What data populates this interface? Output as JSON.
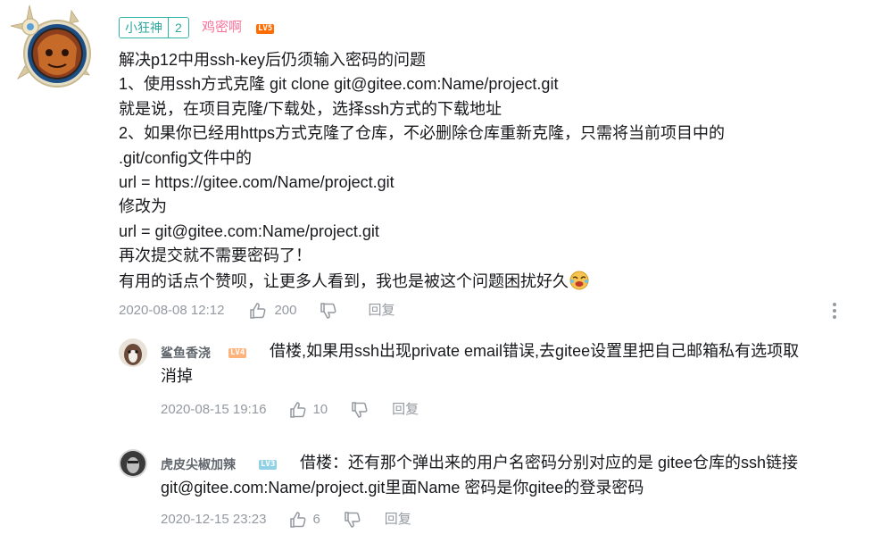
{
  "main_comment": {
    "medal_name": "小狂神",
    "medal_level": "2",
    "username": "鸡密啊",
    "user_level": "LV5",
    "lines": [
      "解决p12中用ssh-key后仍须输入密码的问题",
      "1、使用ssh方式克隆 git clone git@gitee.com:Name/project.git",
      "就是说，在项目克隆/下载处，选择ssh方式的下载地址",
      "2、如果你已经用https方式克隆了仓库，不必删除仓库重新克隆，只需将当前项目中的",
      ".git/config文件中的",
      "url = https://gitee.com/Name/project.git",
      "修改为",
      "url = git@gitee.com:Name/project.git",
      "再次提交就不需要密码了！",
      "有用的话点个赞呗，让更多人看到，我也是被这个问题困扰好久"
    ],
    "time": "2020-08-08 12:12",
    "likes": "200",
    "reply_label": "回复"
  },
  "replies": [
    {
      "username": "鲨鱼香浇",
      "user_level": "LV4",
      "text_line1": "借楼,如果用ssh出现private email错误,去gitee设置里把自己邮箱私有选项取",
      "text_line2": "消掉",
      "time": "2020-08-15 19:16",
      "likes": "10",
      "reply_label": "回复"
    },
    {
      "username": "虎皮尖椒加辣",
      "user_level": "LV3",
      "text_line1": "借楼：还有那个弹出来的用户名密码分别对应的是 gitee仓库的ssh链接",
      "text_line2": "git@gitee.com:Name/project.git里面Name 密码是你gitee的登录密码",
      "time": "2020-12-15 23:23",
      "likes": "6",
      "reply_label": "回复"
    }
  ],
  "icons": {
    "like": "thumbs-up-icon",
    "dislike": "thumbs-down-icon",
    "more": "more-vertical-icon",
    "emoji": "doge-crying-laughing-icon"
  },
  "colors": {
    "text": "#18191c",
    "meta": "#9499a0",
    "username_vip": "#fb7299",
    "medal": "#2eb4a6",
    "lv5": "#ff6c00",
    "lv4": "#ffb37c",
    "lv3": "#92d1e5"
  }
}
